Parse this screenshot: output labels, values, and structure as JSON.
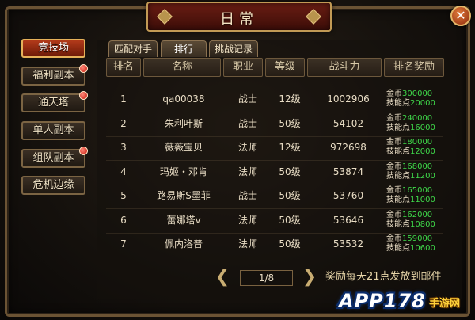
{
  "window": {
    "title": "日常",
    "close_icon": "close-icon"
  },
  "sidebar": {
    "items": [
      {
        "label": "竞技场",
        "active": true,
        "badge": false
      },
      {
        "label": "福利副本",
        "active": false,
        "badge": true
      },
      {
        "label": "通天塔",
        "active": false,
        "badge": true
      },
      {
        "label": "单人副本",
        "active": false,
        "badge": false
      },
      {
        "label": "组队副本",
        "active": false,
        "badge": true
      },
      {
        "label": "危机边缘",
        "active": false,
        "badge": false
      }
    ]
  },
  "tabs": [
    {
      "label": "匹配对手",
      "active": false
    },
    {
      "label": "排行",
      "active": true
    },
    {
      "label": "挑战记录",
      "active": false
    }
  ],
  "table": {
    "headers": [
      "排名",
      "名称",
      "职业",
      "等级",
      "战斗力",
      "排名奖励"
    ],
    "reward_labels": {
      "gold": "金币",
      "skill": "技能点"
    },
    "rows": [
      {
        "rank": "1",
        "name": "qa00038",
        "job": "战士",
        "level": "12级",
        "power": "1002906",
        "gold": "300000",
        "skill": "20000"
      },
      {
        "rank": "2",
        "name": "朱利叶斯",
        "job": "战士",
        "level": "50级",
        "power": "54102",
        "gold": "240000",
        "skill": "16000"
      },
      {
        "rank": "3",
        "name": "薇薇宝贝",
        "job": "法师",
        "level": "12级",
        "power": "972698",
        "gold": "180000",
        "skill": "12000"
      },
      {
        "rank": "4",
        "name": "玛姬・邓肯",
        "job": "法师",
        "level": "50级",
        "power": "53874",
        "gold": "168000",
        "skill": "11200"
      },
      {
        "rank": "5",
        "name": "路易斯S墨菲",
        "job": "战士",
        "level": "50级",
        "power": "53760",
        "gold": "165000",
        "skill": "11000"
      },
      {
        "rank": "6",
        "name": "蕾娜塔v",
        "job": "法师",
        "level": "50级",
        "power": "53646",
        "gold": "162000",
        "skill": "10800"
      },
      {
        "rank": "7",
        "name": "佩内洛普",
        "job": "法师",
        "level": "50级",
        "power": "53532",
        "gold": "159000",
        "skill": "10600"
      }
    ]
  },
  "pager": {
    "label": "1/8",
    "prev_icon": "chevron-left-icon",
    "next_icon": "chevron-right-icon"
  },
  "notice": "奖励每天21点发放到邮件",
  "watermark": {
    "main": "APP178",
    "sub": "手游网"
  },
  "colors": {
    "accent": "#b23a1a",
    "reward_value": "#3fd94a",
    "gold_trim": "#c29a55"
  }
}
